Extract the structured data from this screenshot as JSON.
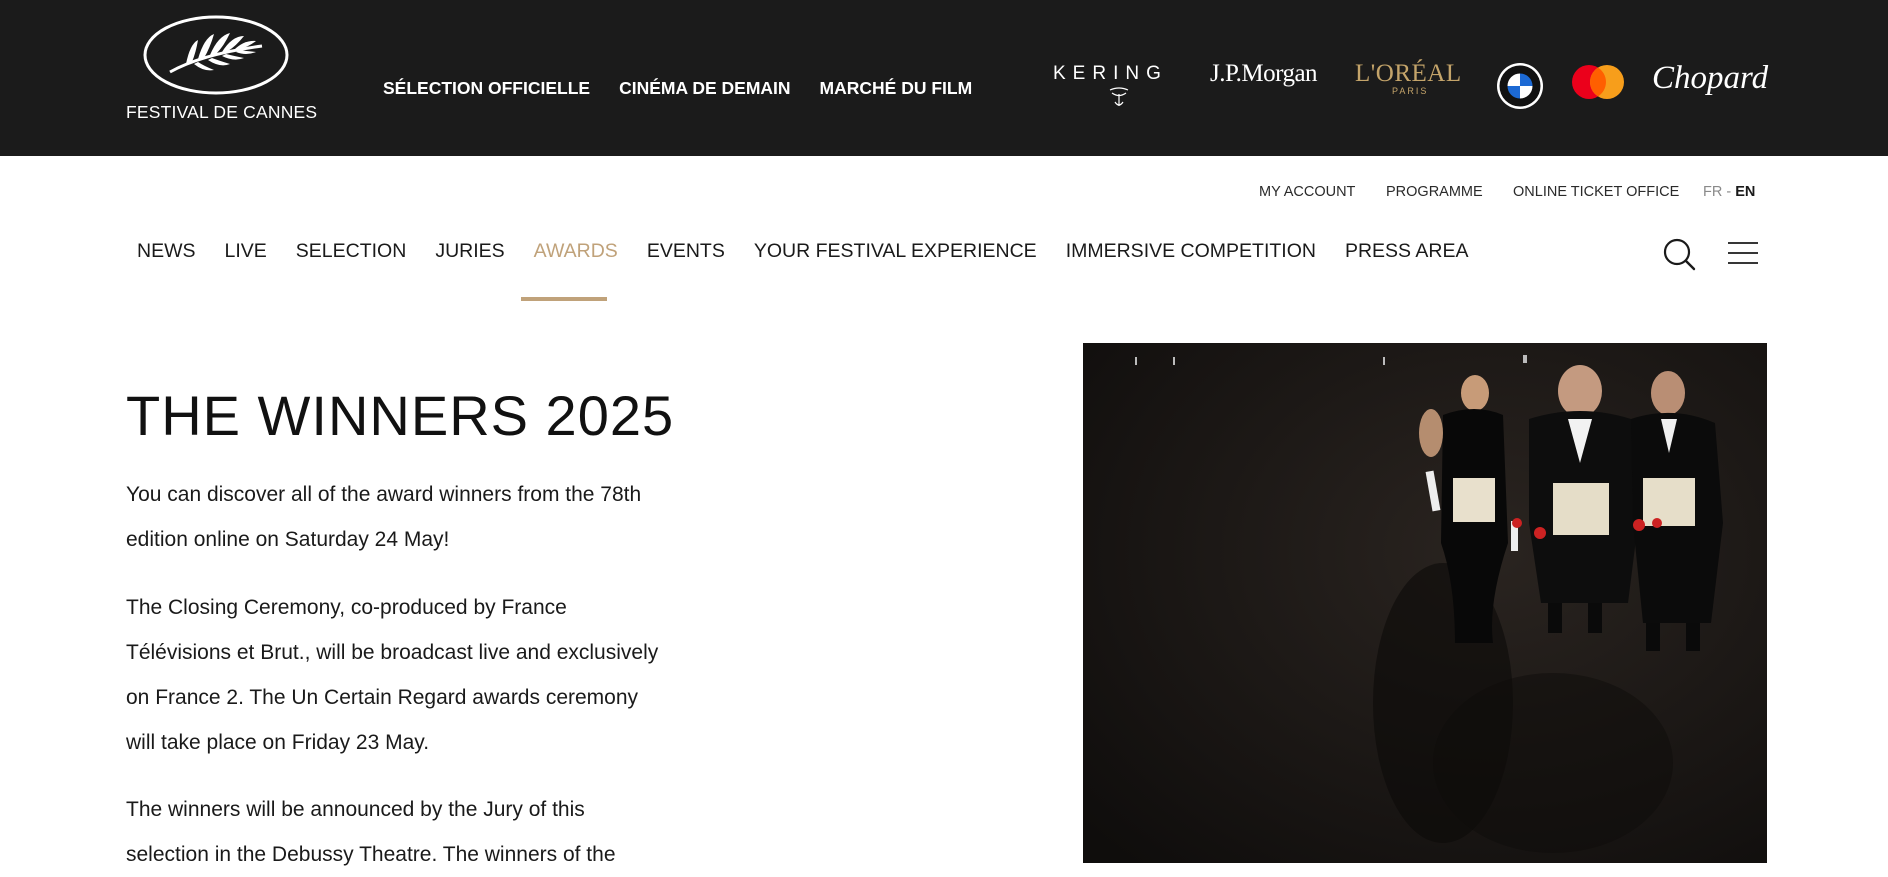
{
  "brand": {
    "logo_text": "FESTIVAL DE CANNES"
  },
  "top_nav": [
    {
      "label": "SÉLECTION OFFICIELLE"
    },
    {
      "label": "CINÉMA DE DEMAIN"
    },
    {
      "label": "MARCHÉ DU FILM"
    }
  ],
  "sponsors": {
    "kering": "KERING",
    "jpmorgan": "J.P.Morgan",
    "loreal": "L'ORÉAL",
    "loreal_sub": "PARIS",
    "chopard": "Chopard"
  },
  "utility_nav": {
    "account": "MY ACCOUNT",
    "programme": "PROGRAMME",
    "ticket_office": "ONLINE TICKET OFFICE",
    "lang_fr": "FR",
    "lang_sep": "-",
    "lang_en": "EN"
  },
  "main_nav": [
    {
      "label": "NEWS"
    },
    {
      "label": "LIVE"
    },
    {
      "label": "SELECTION"
    },
    {
      "label": "JURIES"
    },
    {
      "label": "AWARDS",
      "active": true
    },
    {
      "label": "EVENTS"
    },
    {
      "label": "YOUR FESTIVAL EXPERIENCE"
    },
    {
      "label": "IMMERSIVE COMPETITION"
    },
    {
      "label": "PRESS AREA"
    }
  ],
  "content": {
    "title": "THE WINNERS 2025",
    "paragraphs": [
      "You can discover all of the award winners from the 78th edition online on Saturday 24 May!",
      "The Closing Ceremony, co-produced by France Télévisions et Brut., will be broadcast live and exclusively on France 2. The Un Certain Regard awards ceremony will take place on Friday 23 May.",
      "The winners will be announced by the Jury of this selection in the Debussy Theatre. The winners of the"
    ]
  },
  "colors": {
    "topbar": "#1b1b1b",
    "accent_gold": "#c0a27a",
    "loreal_gold": "#c4a46a"
  },
  "icons": [
    "palm-leaf-icon",
    "search-icon",
    "hamburger-menu-icon",
    "bmw-logo-icon",
    "mastercard-logo-icon"
  ]
}
